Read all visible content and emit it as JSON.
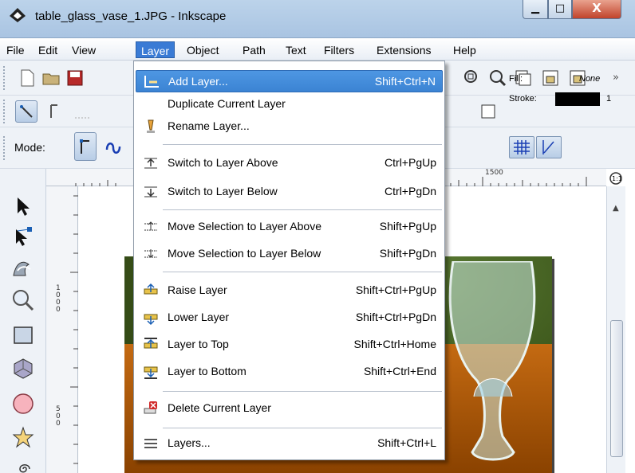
{
  "window": {
    "title": "table_glass_vase_1.JPG - Inkscape",
    "minimize_glyph": "▁",
    "maximize_glyph": "□",
    "close_glyph": "X"
  },
  "menubar": {
    "file": "File",
    "edit": "Edit",
    "view": "View",
    "layer": "Layer",
    "object": "Object",
    "path": "Path",
    "text": "Text",
    "filters": "Filters",
    "extensions": "Extensions",
    "help": "Help"
  },
  "toolbar": {
    "mode_label": "Mode:",
    "fill_label": "Fill:",
    "fill_value": "None",
    "stroke_label": "Stroke:",
    "stroke_width": "1",
    "more_glyph": "»"
  },
  "ruler": {
    "h_label": "1500",
    "v_label_1": "1\n0\n0\n0",
    "v_label_2": "5\n0\n0"
  },
  "layer_menu": {
    "add_layer": {
      "label": "Add Layer...",
      "shortcut": "Shift+Ctrl+N"
    },
    "duplicate_layer": {
      "label": "Duplicate Current Layer",
      "shortcut": ""
    },
    "rename_layer": {
      "label": "Rename Layer...",
      "shortcut": ""
    },
    "switch_above": {
      "label": "Switch to Layer Above",
      "shortcut": "Ctrl+PgUp"
    },
    "switch_below": {
      "label": "Switch to Layer Below",
      "shortcut": "Ctrl+PgDn"
    },
    "move_above": {
      "label": "Move Selection to Layer Above",
      "shortcut": "Shift+PgUp"
    },
    "move_below": {
      "label": "Move Selection to Layer Below",
      "shortcut": "Shift+PgDn"
    },
    "raise_layer": {
      "label": "Raise Layer",
      "shortcut": "Shift+Ctrl+PgUp"
    },
    "lower_layer": {
      "label": "Lower Layer",
      "shortcut": "Shift+Ctrl+PgDn"
    },
    "layer_top": {
      "label": "Layer to Top",
      "shortcut": "Shift+Ctrl+Home"
    },
    "layer_bottom": {
      "label": "Layer to Bottom",
      "shortcut": "Shift+Ctrl+End"
    },
    "delete_layer": {
      "label": "Delete Current Layer",
      "shortcut": ""
    },
    "layers": {
      "label": "Layers...",
      "shortcut": "Shift+Ctrl+L"
    }
  },
  "colors": {
    "menu_highlight": "#3b83d3",
    "titlebar": "#bcd3ea",
    "close_button": "#c1432b"
  }
}
